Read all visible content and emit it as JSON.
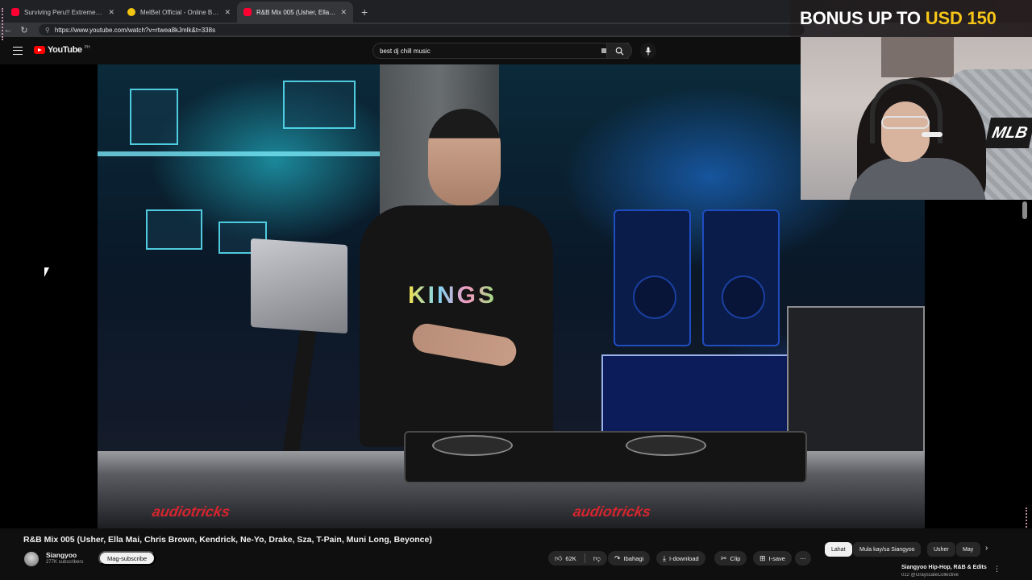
{
  "browser": {
    "tabs": [
      {
        "title": "Surviving Peru!! Extreme Meats In",
        "favicon": "youtube-icon"
      },
      {
        "title": "MelBet Official - Online Betting W",
        "favicon": "melbet-icon"
      },
      {
        "title": "R&B Mix 005 (Usher, Ella Ma",
        "favicon": "youtube-icon",
        "active": true
      }
    ],
    "url": "https://www.youtube.com/watch?v=rtwea8kJmlk&t=338s"
  },
  "masthead": {
    "logo_text": "YouTube",
    "region": "PH",
    "search_value": "best dj chill music"
  },
  "overlay": {
    "bonus_text": "BONUS UP TO",
    "bonus_amount": "USD 150",
    "badge": "MLB"
  },
  "video_scene": {
    "shirt_text": "KINGS",
    "case_brand_left": "audiotricks",
    "case_brand_right": "audiotricks"
  },
  "video": {
    "title": "R&B Mix 005 (Usher, Ella Mai, Chris Brown, Kendrick, Ne-Yo, Drake, Sza, T-Pain, Muni Long, Beyonce)",
    "channel": "Siangyoo",
    "subscribers": "277K subscribers",
    "subscribe_label": "Mag-subscribe",
    "likes": "62K",
    "share_label": "Ibahagi",
    "download_label": "I-download",
    "clip_label": "Clip",
    "save_label": "I-save",
    "more_label": "⋯"
  },
  "chips": [
    "Lahat",
    "Mula kay/sa Siangyoo",
    "Usher",
    "May"
  ],
  "recommendation": {
    "title": "Siangyoo Hip-Hop, R&B & Edits",
    "subtitle": "012 @GrayscaleCollective"
  },
  "colors": {
    "background": "#0f0f0f",
    "brand_red": "#ff0000",
    "bonus_gold": "#f5c518"
  }
}
